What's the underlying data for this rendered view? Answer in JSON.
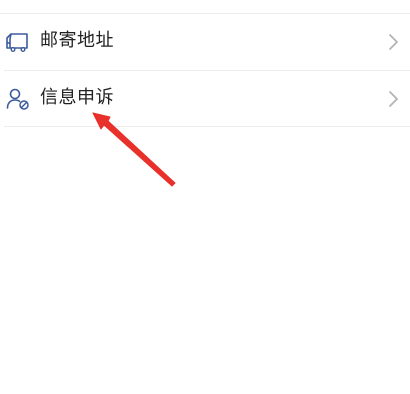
{
  "menu": {
    "items": [
      {
        "label": "邮寄地址",
        "icon": "mail-truck-icon"
      },
      {
        "label": "信息申诉",
        "icon": "user-block-icon"
      }
    ]
  },
  "colors": {
    "icon": "#3b5b9e",
    "label": "#222222",
    "chevron": "#b4b4b4",
    "divider": "#ececec",
    "annotation": "#e8312a"
  }
}
